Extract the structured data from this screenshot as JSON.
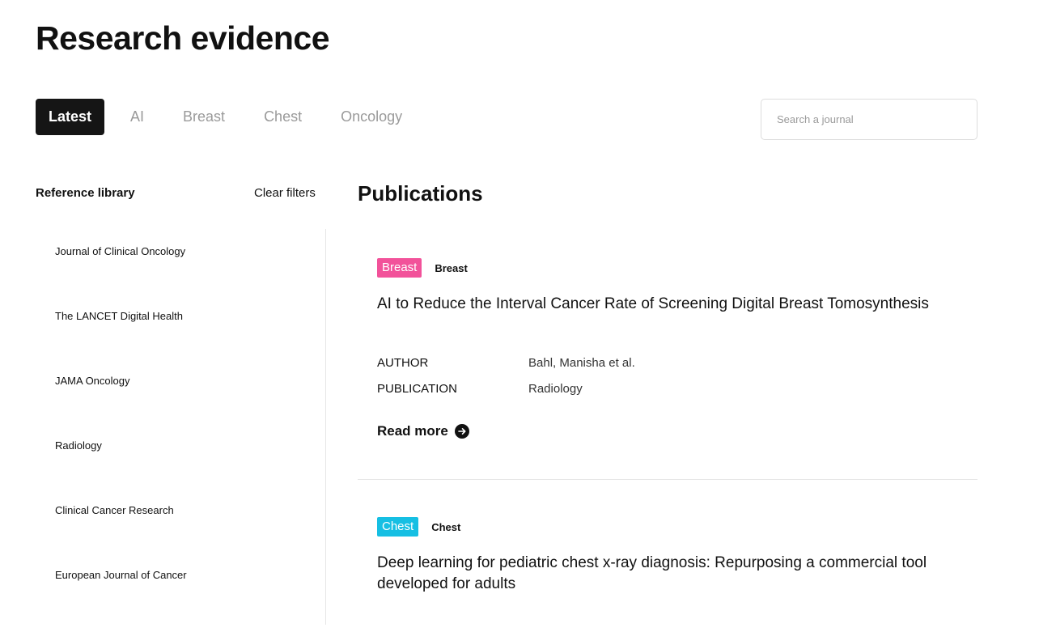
{
  "page": {
    "title": "Research evidence"
  },
  "tabs": [
    {
      "label": "Latest",
      "active": true
    },
    {
      "label": "AI",
      "active": false
    },
    {
      "label": "Breast",
      "active": false
    },
    {
      "label": "Chest",
      "active": false
    },
    {
      "label": "Oncology",
      "active": false
    }
  ],
  "search": {
    "placeholder": "Search a journal",
    "value": ""
  },
  "sidebar": {
    "title": "Reference library",
    "clear_label": "Clear filters",
    "journals": [
      "Journal of Clinical Oncology",
      "The LANCET Digital Health",
      "JAMA Oncology",
      "Radiology",
      "Clinical Cancer Research",
      "European Journal of Cancer"
    ]
  },
  "publications": {
    "heading": "Publications",
    "items": [
      {
        "tag": "Breast",
        "tag_color": "#f2529a",
        "category": "Breast",
        "title": "AI to Reduce the Interval Cancer Rate of Screening Digital Breast Tomosynthesis",
        "author_label": "AUTHOR",
        "author": "Bahl, Manisha et al.",
        "publication_label": "PUBLICATION",
        "publication": "Radiology",
        "read_more": "Read more"
      },
      {
        "tag": "Chest",
        "tag_color": "#16bfe3",
        "category": "Chest",
        "title": "Deep learning for pediatric chest x-ray diagnosis: Repurposing a commercial tool developed for adults"
      }
    ]
  },
  "icons": {
    "read_more": "arrow-right-circle-icon"
  },
  "colors": {
    "active_tab_bg": "#151515",
    "inactive_tab_text": "#9a9a9a",
    "divider": "#e6e6e6"
  }
}
